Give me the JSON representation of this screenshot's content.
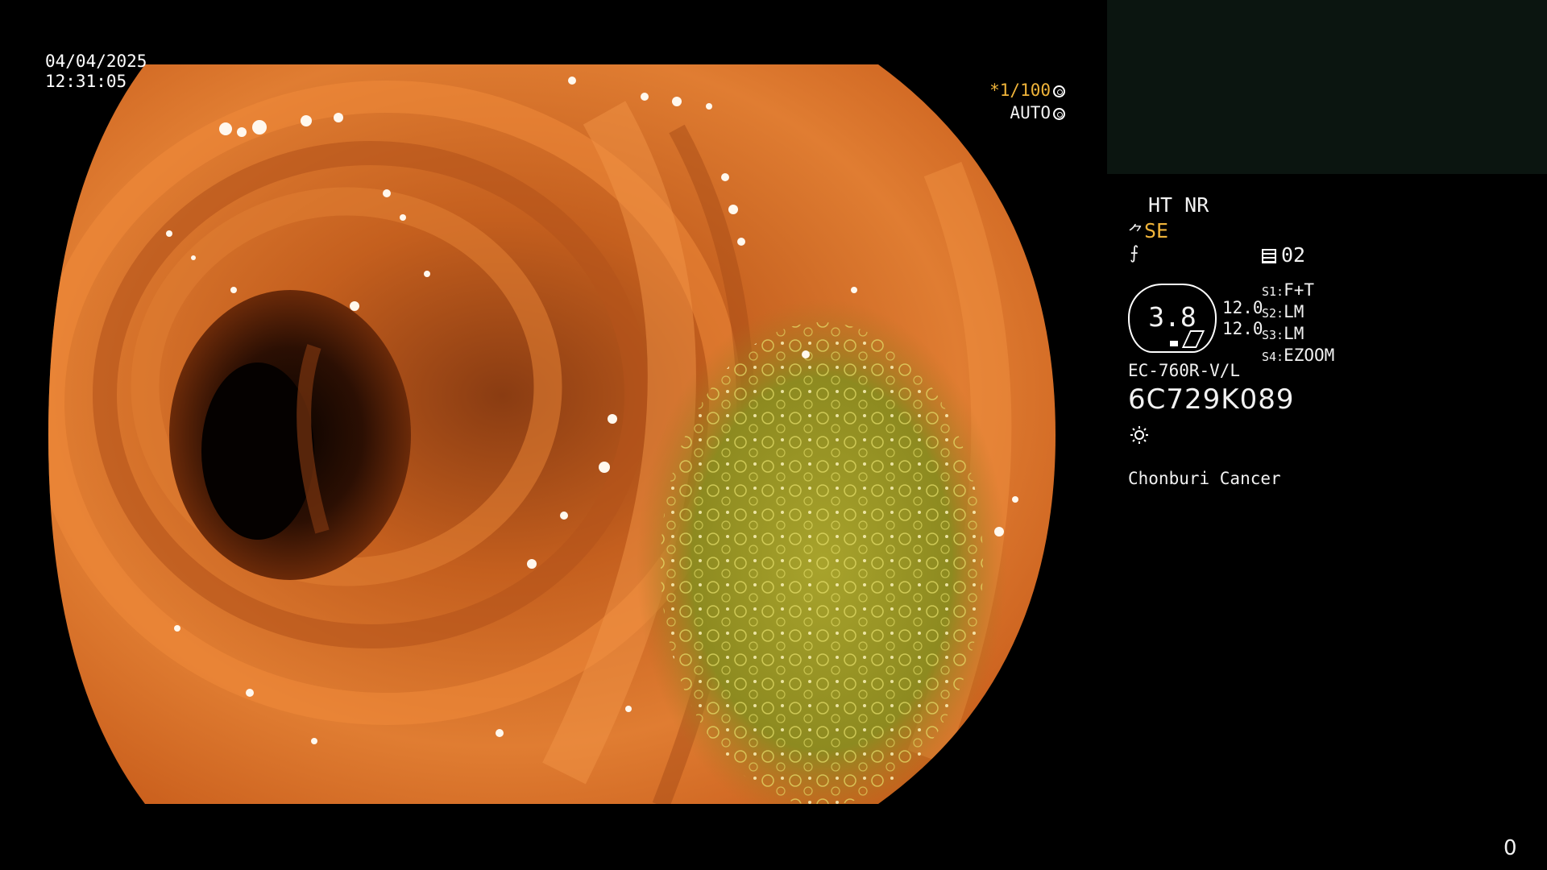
{
  "overlay": {
    "date": "04/04/2025",
    "time": "12:31:05",
    "shutter": "*1/100",
    "shutter_icon": "aperture-icon",
    "auto_label": "AUTO",
    "auto_icon": "iris-icon"
  },
  "panel": {
    "modes": "HT NR",
    "structure_enhance": "SE",
    "memo_number": "02",
    "zoom_value": "3.8",
    "scale_top": "12.0",
    "scale_bottom": "12.0",
    "settings": [
      {
        "key": "S1:",
        "value": "F+T"
      },
      {
        "key": "S2:",
        "value": "LM"
      },
      {
        "key": "S3:",
        "value": "LM"
      },
      {
        "key": "S4:",
        "value": "EZOOM"
      }
    ],
    "scope_model": "EC-760R-V/L",
    "scope_serial": "6C729K089",
    "light_icon": "sun-icon",
    "hospital": "Chonburi Cancer"
  },
  "footer": {
    "counter": "0"
  },
  "colors": {
    "accent": "#f0b43a",
    "background": "#000000",
    "tissue": "#d9782a",
    "fluid": "#9aa12a"
  }
}
